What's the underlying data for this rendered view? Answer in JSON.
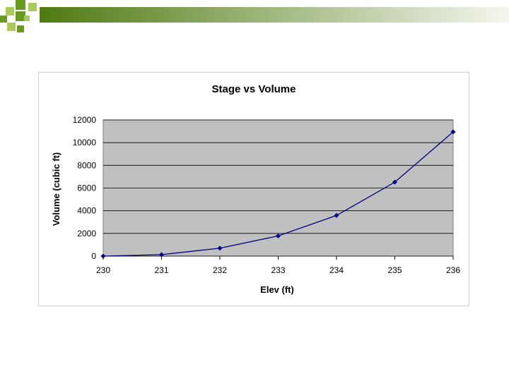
{
  "theme": {
    "banner_gradient": [
      "#4f7a12",
      "#f4f6ee"
    ],
    "squares_dark": "#6a9a1f",
    "squares_light": "#a9c95a",
    "plot_bg": "#c0c0c0",
    "series_color": "#000080"
  },
  "chart_data": {
    "type": "line",
    "title": "Stage vs Volume",
    "xlabel": "Elev (ft)",
    "ylabel": "Volume (cubic ft)",
    "x": [
      230,
      231,
      232,
      233,
      234,
      235,
      236
    ],
    "series": [
      {
        "values": [
          0,
          130,
          700,
          1780,
          3580,
          6520,
          10950
        ]
      }
    ],
    "xlim": [
      230,
      236
    ],
    "ylim": [
      0,
      12000
    ],
    "xticks": [
      230,
      231,
      232,
      233,
      234,
      235,
      236
    ],
    "yticks": [
      0,
      2000,
      4000,
      6000,
      8000,
      10000,
      12000
    ],
    "grid": true,
    "legend": "none",
    "marker": "diamond"
  }
}
